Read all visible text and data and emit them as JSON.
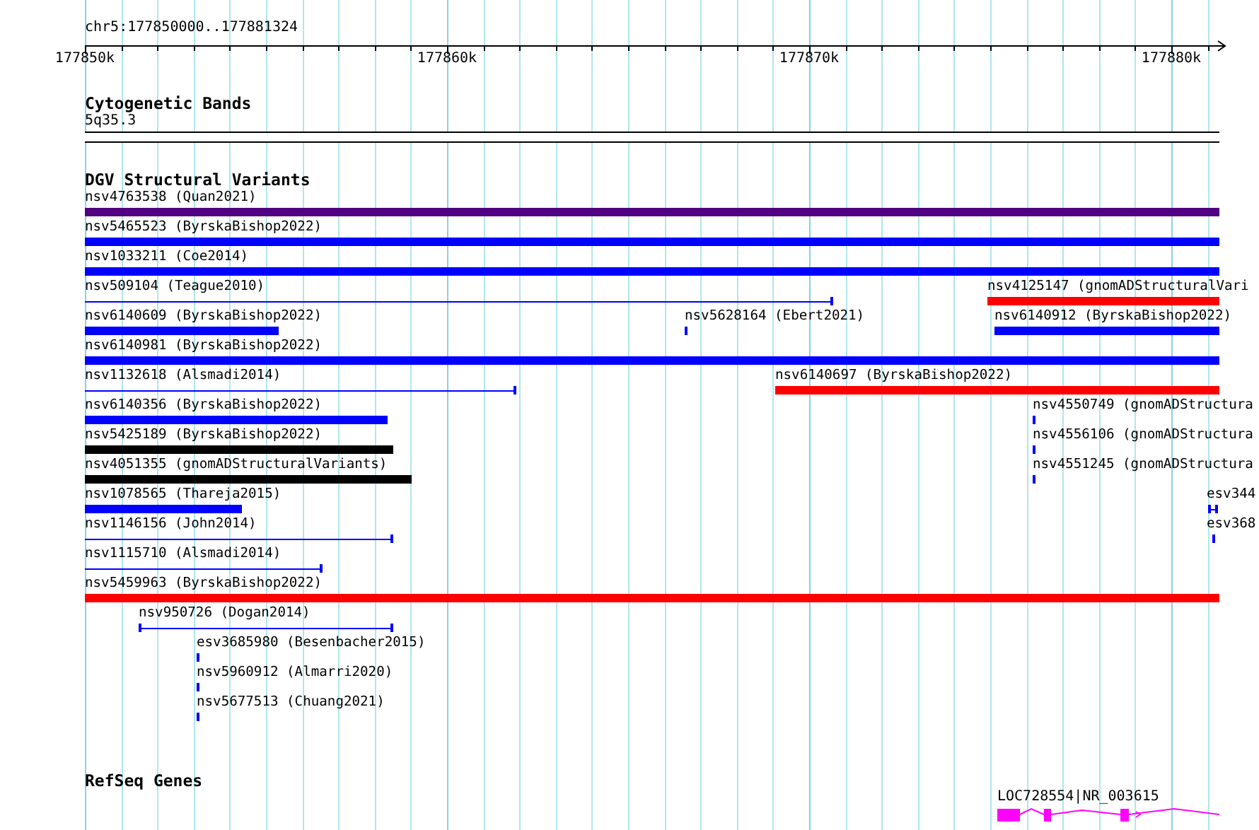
{
  "ruler": {
    "title": "chr5:177850000..177881324",
    "ticks": [
      "177850k",
      "177860k",
      "177870k",
      "177880k"
    ]
  },
  "tracks": [
    {
      "kind": "cytoband",
      "title": "Cytogenetic Bands",
      "bands": [
        {
          "name": "5q35.3"
        }
      ]
    },
    {
      "kind": "variants",
      "title": "DGV Structural Variants",
      "features": [
        {
          "label": "nsv4763538 (Quan2021)",
          "kind": "thick",
          "color": "#500080"
        },
        {
          "label": "nsv5465523 (ByrskaBishop2022)",
          "kind": "thick",
          "color": "#0000ff"
        },
        {
          "label": "nsv1033211 (Coe2014)",
          "kind": "thick",
          "color": "#0000ff"
        },
        {
          "label": "nsv509104 (Teague2010)",
          "kind": "thin",
          "color": "#0000ff"
        },
        {
          "label": "nsv4125147 (gnomADStructuralVari",
          "kind": "thick",
          "color": "#ff0000"
        },
        {
          "label": "nsv6140609 (ByrskaBishop2022)",
          "kind": "thick",
          "color": "#0000ff"
        },
        {
          "label": "nsv5628164 (Ebert2021)",
          "kind": "point",
          "color": "#0000ff"
        },
        {
          "label": "nsv6140912 (ByrskaBishop2022)",
          "kind": "thick",
          "color": "#0000ff"
        },
        {
          "label": "nsv6140981 (ByrskaBishop2022)",
          "kind": "thick",
          "color": "#0000ff"
        },
        {
          "label": "nsv1132618 (Alsmadi2014)",
          "kind": "thin",
          "color": "#0000ff"
        },
        {
          "label": "nsv6140697 (ByrskaBishop2022)",
          "kind": "thick",
          "color": "#ff0000"
        },
        {
          "label": "nsv6140356 (ByrskaBishop2022)",
          "kind": "thick",
          "color": "#0000ff"
        },
        {
          "label": "nsv4550749 (gnomADStructura",
          "kind": "point",
          "color": "#0000ff"
        },
        {
          "label": "nsv5425189 (ByrskaBishop2022)",
          "kind": "thick",
          "color": "#000000"
        },
        {
          "label": "nsv4556106 (gnomADStructura",
          "kind": "point",
          "color": "#0000ff"
        },
        {
          "label": "nsv4051355 (gnomADStructuralVariants)",
          "kind": "thick",
          "color": "#000000"
        },
        {
          "label": "nsv4551245 (gnomADStructura",
          "kind": "point",
          "color": "#0000ff"
        },
        {
          "label": "nsv1078565 (Thareja2015)",
          "kind": "thick",
          "color": "#0000ff"
        },
        {
          "label": "esv344",
          "kind": "thin",
          "color": "#0000ff"
        },
        {
          "label": "nsv1146156 (John2014)",
          "kind": "thin",
          "color": "#0000ff"
        },
        {
          "label": "esv368",
          "kind": "point",
          "color": "#0000ff"
        },
        {
          "label": "nsv1115710 (Alsmadi2014)",
          "kind": "thin",
          "color": "#0000ff"
        },
        {
          "label": "nsv5459963 (ByrskaBishop2022)",
          "kind": "thick",
          "color": "#ff0000"
        },
        {
          "label": "nsv950726 (Dogan2014)",
          "kind": "thin",
          "color": "#0000ff"
        },
        {
          "label": "esv3685980 (Besenbacher2015)",
          "kind": "point",
          "color": "#0000ff"
        },
        {
          "label": "nsv5960912 (Almarri2020)",
          "kind": "point",
          "color": "#0000ff"
        },
        {
          "label": "nsv5677513 (Chuang2021)",
          "kind": "point",
          "color": "#0000ff"
        }
      ]
    },
    {
      "kind": "genes",
      "title": "RefSeq Genes",
      "features": [
        {
          "label": "LOC728554|NR_003615",
          "color": "#ff00ff"
        }
      ]
    }
  ]
}
